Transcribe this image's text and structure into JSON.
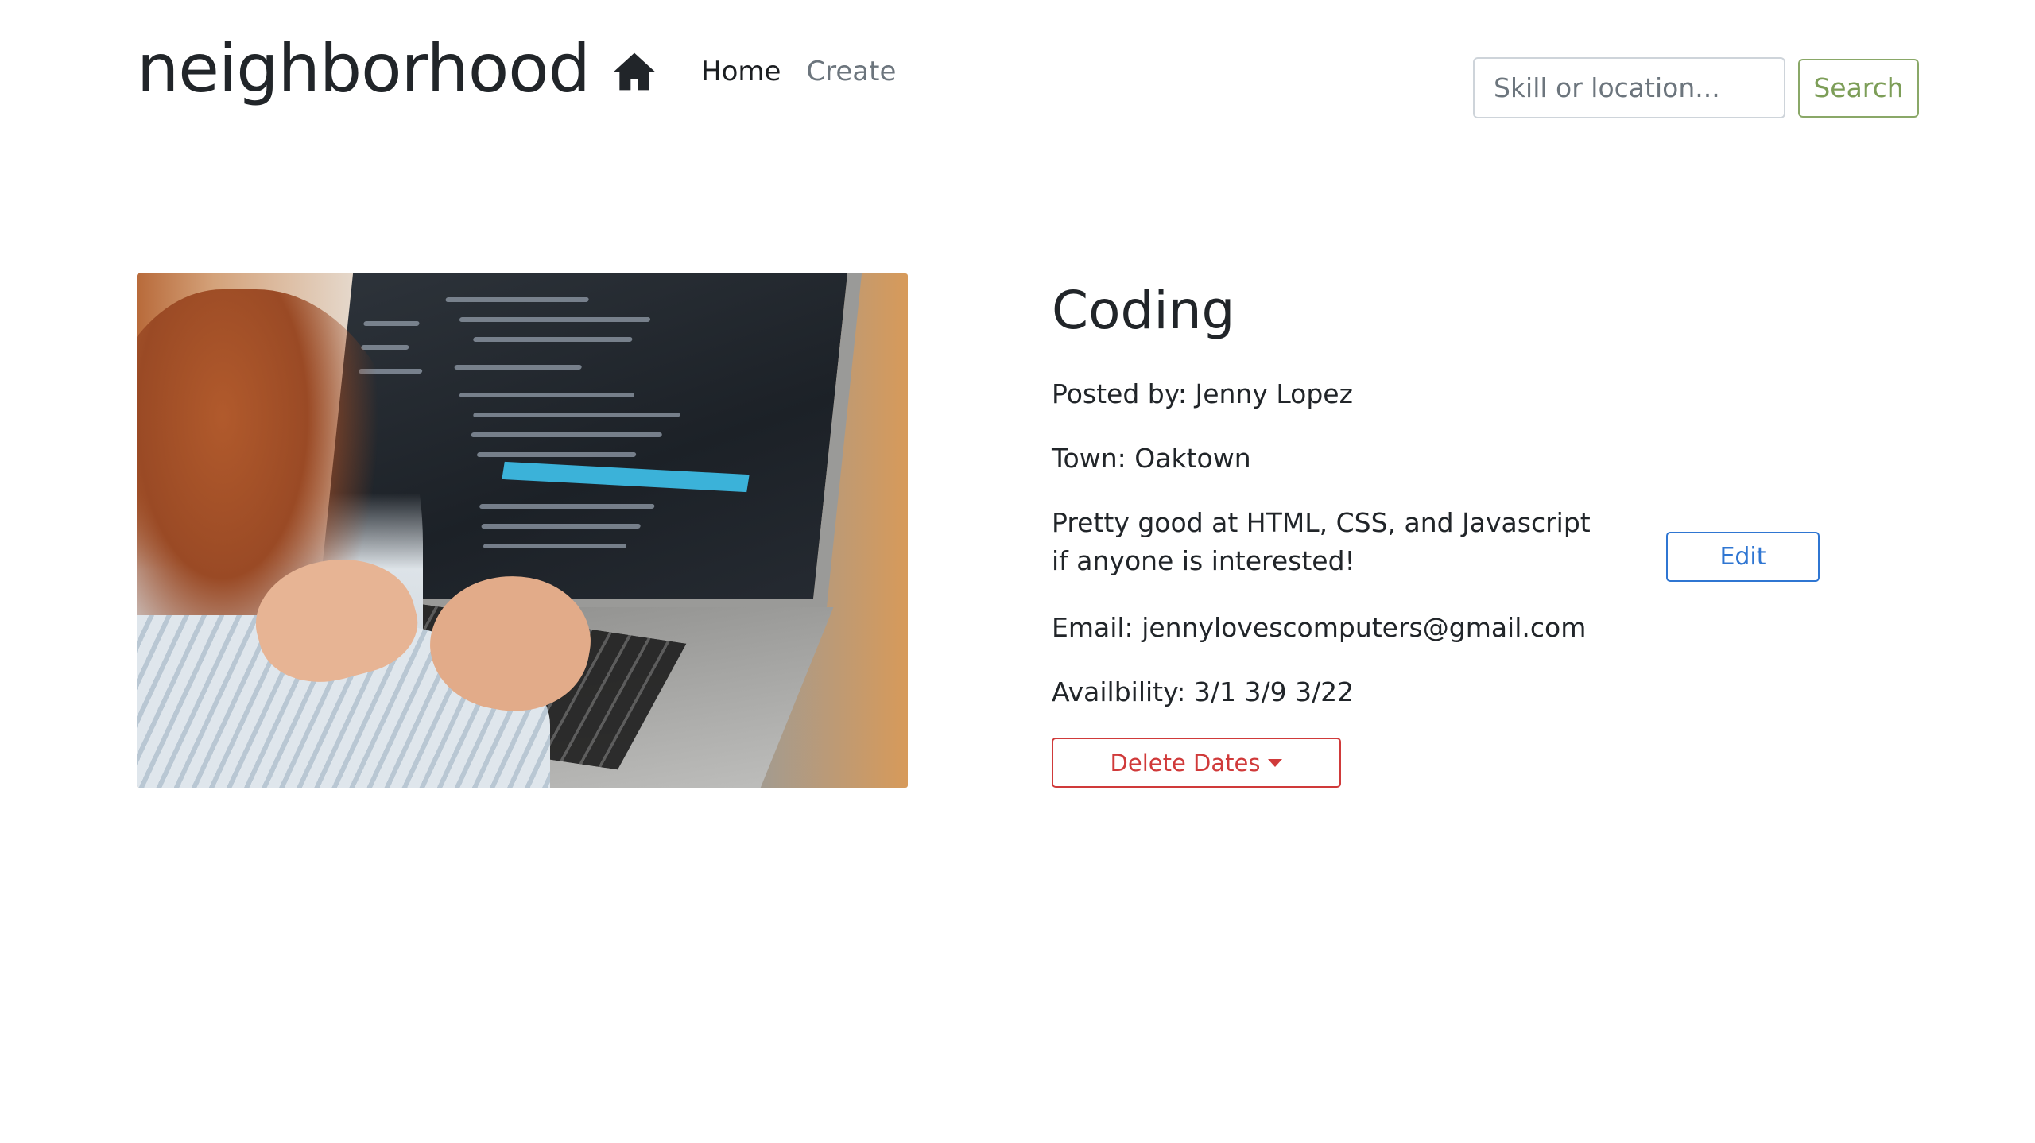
{
  "header": {
    "brand": "neighborhood",
    "brand_icon": "home-icon",
    "nav": [
      {
        "label": "Home",
        "active": true
      },
      {
        "label": "Create",
        "active": false
      }
    ],
    "search": {
      "placeholder": "Skill or location...",
      "button_label": "Search"
    }
  },
  "listing": {
    "image_alt": "Person coding on a laptop",
    "title": "Coding",
    "posted_by_label": "Posted by:",
    "posted_by": "Jenny Lopez",
    "town_label": "Town:",
    "town": "Oaktown",
    "description": "Pretty good at HTML, CSS, and Javascript if anyone is interested!",
    "email_label": "Email:",
    "email": "jennylovescomputers@gmail.com",
    "availability_label": "Availbility:",
    "availability": "3/1 3/9 3/22",
    "delete_dates_label": "Delete Dates",
    "edit_label": "Edit"
  },
  "colors": {
    "search_accent": "#7d9e58",
    "danger": "#d03a3a",
    "primary": "#2f76d2"
  }
}
